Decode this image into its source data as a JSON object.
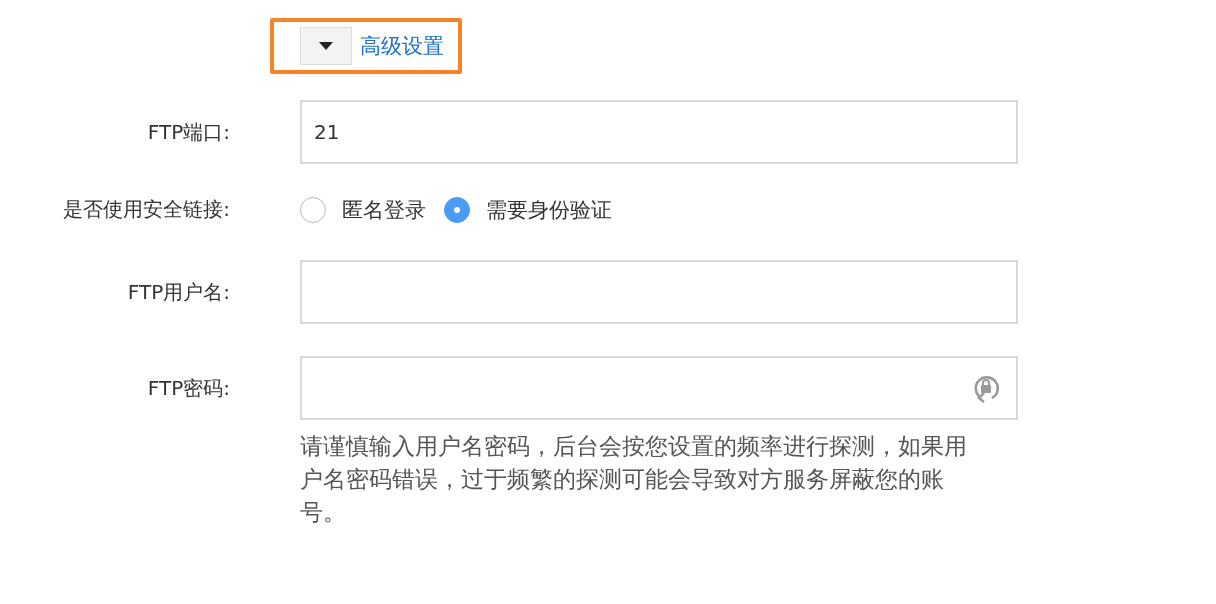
{
  "advanced_toggle": {
    "label": "高级设置",
    "expanded": true
  },
  "fields": [
    {
      "kind": "input",
      "label": "FTP端口:",
      "value": "21"
    },
    {
      "kind": "radio",
      "label": "是否使用安全链接:",
      "options": [
        {
          "label": "匿名登录",
          "selected": false
        },
        {
          "label": "需要身份验证",
          "selected": true
        }
      ]
    },
    {
      "kind": "input",
      "label": "FTP用户名:"
    },
    {
      "kind": "password",
      "label": "FTP密码:",
      "help": "请谨慎输入用户名密码，后台会按您设置的频率进行探测，如果用户名密码错误，过于频繁的探测可能会导致对方服务屏蔽您的账号。"
    }
  ]
}
